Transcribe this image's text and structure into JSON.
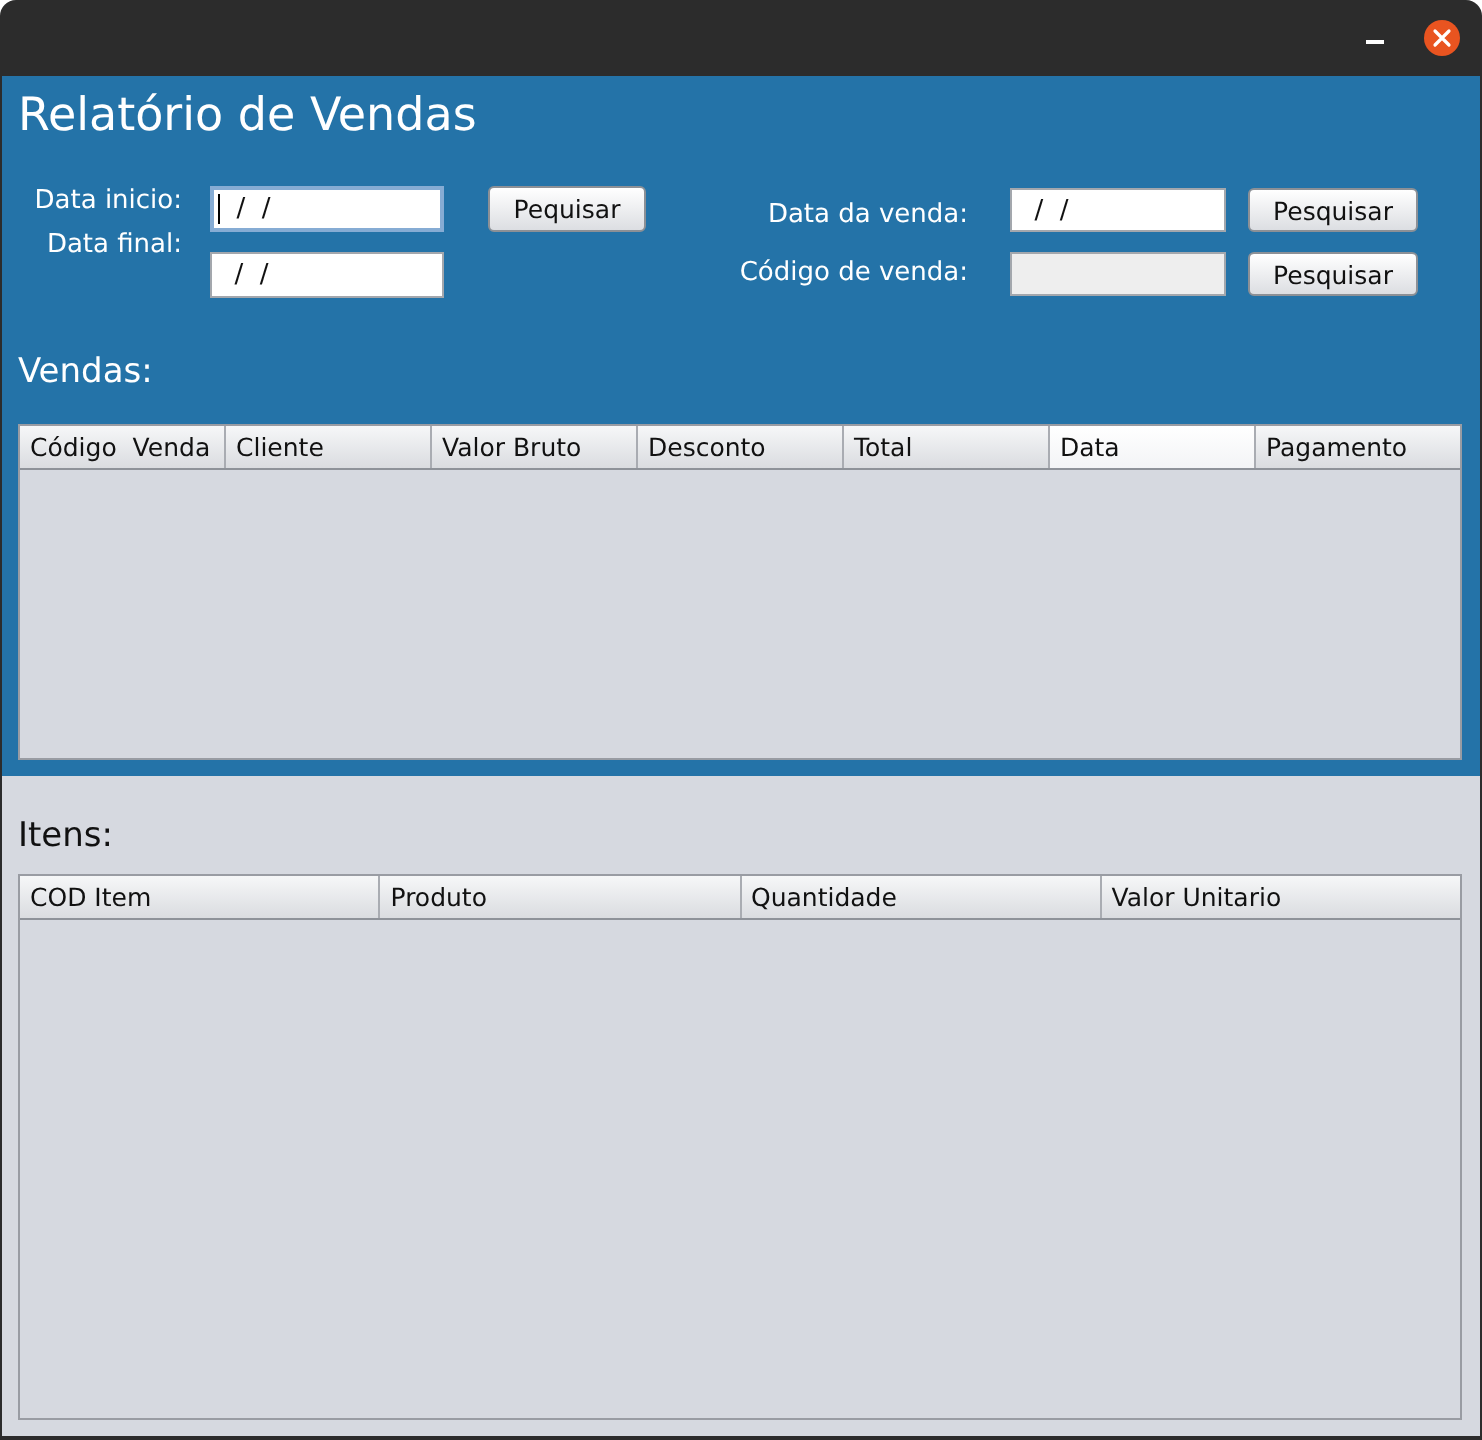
{
  "title": "Relatório de Vendas",
  "period_search": {
    "labels": [
      "Data inicio:",
      "Data final:"
    ],
    "fields": [
      {
        "value": "  /  /",
        "focused": true
      },
      {
        "value": "  /  /",
        "focused": false
      }
    ],
    "button": "Pequisar"
  },
  "sale_search": {
    "rows": [
      {
        "label": "Data da venda:",
        "value": "  /  /",
        "disabled": false,
        "button": "Pesquisar"
      },
      {
        "label": "Código de venda:",
        "disabled": true,
        "button": "Pesquisar"
      }
    ]
  },
  "sales_table": {
    "title": "Vendas:",
    "columns": [
      {
        "label": "Código  Venda",
        "highlighted": false
      },
      {
        "label": "Cliente",
        "highlighted": false
      },
      {
        "label": "Valor Bruto",
        "highlighted": false
      },
      {
        "label": "Desconto",
        "highlighted": false
      },
      {
        "label": "Total",
        "highlighted": false
      },
      {
        "label": "Data",
        "highlighted": true
      },
      {
        "label": "Pagamento",
        "highlighted": false
      }
    ]
  },
  "items_table": {
    "title": "Itens:",
    "columns": [
      {
        "label": "COD Item",
        "highlighted": false
      },
      {
        "label": "Produto",
        "highlighted": false
      },
      {
        "label": "Quantidade",
        "highlighted": false
      },
      {
        "label": "Valor Unitario",
        "highlighted": false
      }
    ]
  }
}
